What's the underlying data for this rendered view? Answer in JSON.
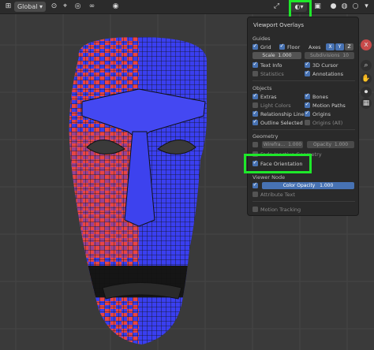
{
  "header": {
    "transform_orientation": "Global",
    "icons": [
      "view-icon",
      "link-icon",
      "snap-icon",
      "proportional-edit-icon",
      "gizmo-icon",
      "overlay-icon",
      "xray-icon",
      "shading-solid-icon",
      "shading-material-icon",
      "shading-rendered-icon"
    ]
  },
  "overlay_panel": {
    "title": "Viewport Overlays",
    "guides": {
      "heading": "Guides",
      "grid": "Grid",
      "floor": "Floor",
      "axes": "Axes",
      "axis_x": "X",
      "axis_y": "Y",
      "axis_z": "Z",
      "scale_label": "Scale",
      "scale_value": "1.000",
      "subdivisions_label": "Subdivisions",
      "subdivisions_value": "10",
      "text_info": "Text Info",
      "cursor": "3D Cursor",
      "statistics": "Statistics",
      "annotations": "Annotations"
    },
    "objects": {
      "heading": "Objects",
      "extras": "Extras",
      "bones": "Bones",
      "light_colors": "Light Colors",
      "motion_paths": "Motion Paths",
      "relationship_lines": "Relationship Lines",
      "origins": "Origins",
      "outline_selected": "Outline Selected",
      "origins_all": "Origins (All)"
    },
    "geometry": {
      "heading": "Geometry",
      "wireframe_label": "Wirefra...",
      "wireframe_value": "1.000",
      "opacity_label": "Opacity",
      "opacity_value": "1.000",
      "fade_label": "Fade Inactive Geometry",
      "face_orientation": "Face Orientation"
    },
    "viewer_node": {
      "heading": "Viewer Node",
      "color_opacity_label": "Color Opacity",
      "color_opacity_value": "1.000",
      "attribute_text": "Attribute Text"
    },
    "motion_tracking": "Motion Tracking"
  },
  "colors": {
    "front_face": "#3a3ff0",
    "back_face": "#e84545",
    "highlight": "#1ee82a",
    "accent": "#4772b3"
  }
}
